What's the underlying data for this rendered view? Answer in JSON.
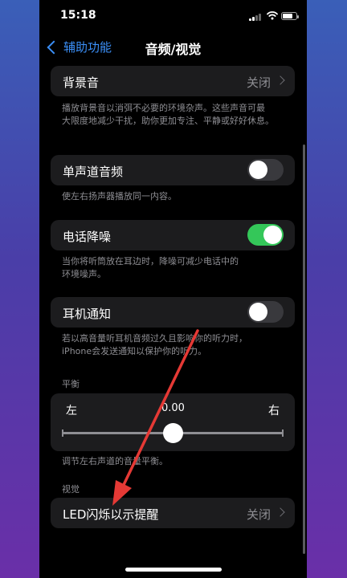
{
  "status_bar": {
    "time": "15:18"
  },
  "nav": {
    "back_label": "辅助功能",
    "title": "音频/视觉"
  },
  "rows": {
    "background_sound": {
      "label": "背景音",
      "value": "关闭"
    },
    "background_desc": [
      "播放背景音以消弭不必要的环境杂声。这些声音可最",
      "大限度地减少干扰，助你更加专注、平静或好好休息。"
    ],
    "mono_audio": {
      "label": "单声道音频",
      "on": false
    },
    "mono_desc": "使左右扬声器播放同一内容。",
    "phone_nc": {
      "label": "电话降噪",
      "on": true
    },
    "phone_nc_desc": [
      "当你将听筒放在耳边时，降噪可减少电话中的",
      "环境噪声。"
    ],
    "headphone_notify": {
      "label": "耳机通知",
      "on": false
    },
    "headphone_desc": [
      "若以高音量听耳机音频过久且影响你的听力时，",
      "iPhone会发送通知以保护你的听力。"
    ]
  },
  "balance": {
    "header": "平衡",
    "left": "左",
    "right": "右",
    "value": "0.00",
    "desc": "调节左右声道的音量平衡。"
  },
  "visual": {
    "header": "视觉",
    "led_flash": {
      "label": "LED闪烁以示提醒",
      "value": "关闭"
    }
  },
  "colors": {
    "accent": "#3b8ff7",
    "toggle_on": "#34c759",
    "annotation": "#e53935"
  }
}
